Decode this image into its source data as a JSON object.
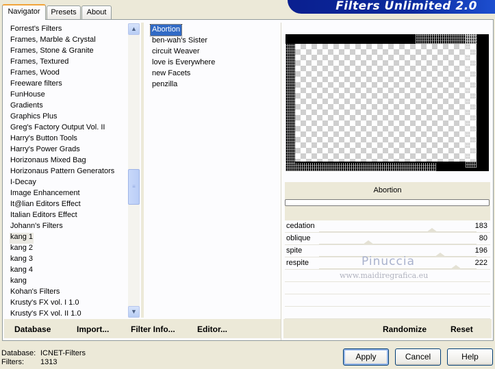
{
  "header": {
    "title": "Filters Unlimited 2.0"
  },
  "tabs": [
    {
      "label": "Navigator",
      "active": true
    },
    {
      "label": "Presets",
      "active": false
    },
    {
      "label": "About",
      "active": false
    }
  ],
  "categories": {
    "items": [
      "Forrest's Filters",
      "Frames, Marble & Crystal",
      "Frames, Stone & Granite",
      "Frames, Textured",
      "Frames, Wood",
      "Freeware filters",
      "FunHouse",
      "Gradients",
      "Graphics Plus",
      "Greg's Factory Output Vol. II",
      "Harry's Button Tools",
      "Harry's Power Grads",
      "Horizonaus Mixed Bag",
      "Horizonaus Pattern Generators",
      "I-Decay",
      "Image Enhancement",
      "It@lian Editors Effect",
      "Italian Editors Effect",
      "Johann's Filters",
      "kang 1",
      "kang 2",
      "kang 3",
      "kang 4",
      "kang",
      "Kohan's Filters",
      "Krusty's FX vol. I 1.0",
      "Krusty's FX vol. II 1.0"
    ],
    "selected": "kang 1"
  },
  "filters": {
    "items": [
      "Abortion",
      "ben-wah's Sister",
      "circuit Weaver",
      "love is Everywhere",
      "new Facets",
      "penzilla"
    ],
    "selected": "Abortion"
  },
  "selected_filter_label": "Abortion",
  "parameters": [
    {
      "name": "cedation",
      "value": "183",
      "level": 183
    },
    {
      "name": "oblique",
      "value": "80",
      "level": 80
    },
    {
      "name": "spite",
      "value": "196",
      "level": 196
    },
    {
      "name": "respite",
      "value": "222",
      "level": 222
    }
  ],
  "watermark": {
    "line1": "Pinuccia",
    "line2": "www.maidiregrafica.eu"
  },
  "toolbar_left": {
    "database": "Database",
    "import": "Import...",
    "filter_info": "Filter Info...",
    "editor": "Editor..."
  },
  "toolbar_right": {
    "randomize": "Randomize",
    "reset": "Reset"
  },
  "status": {
    "database_label": "Database:",
    "database_value": "ICNET-Filters",
    "filters_label": "Filters:",
    "filters_value": "1313"
  },
  "buttons": {
    "apply": "Apply",
    "cancel": "Cancel",
    "help": "Help"
  },
  "icons": {
    "scroll_up": "chevron-up-icon",
    "scroll_down": "chevron-down-icon",
    "scroll_grip": "grip-icon"
  }
}
